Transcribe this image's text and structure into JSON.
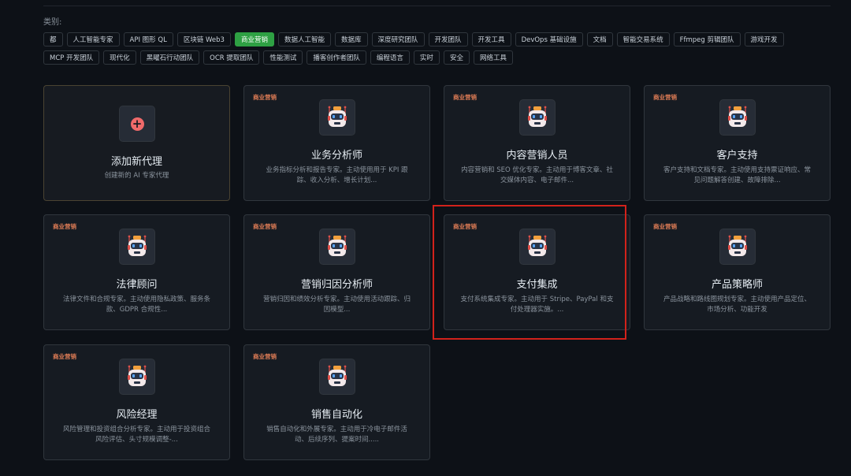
{
  "filter": {
    "label": "类别:",
    "tags": [
      "都",
      "人工智能专家",
      "API 图形 QL",
      "区块链 Web3",
      "商业营销",
      "数据人工智能",
      "数据库",
      "深度研究团队",
      "开发团队",
      "开发工具",
      "DevOps 基础设施",
      "文档",
      "智能交易系统",
      "Ffmpeg 剪辑团队",
      "游戏开发",
      "MCP 开发团队",
      "现代化",
      "黑曜石行动团队",
      "OCR 提取团队",
      "性能测试",
      "播客创作者团队",
      "编程语言",
      "实时",
      "安全",
      "网络工具"
    ],
    "active": "商业营销"
  },
  "add_card": {
    "title": "添加新代理",
    "subtitle": "创建新的 AI 专家代理",
    "icon": "plus-icon"
  },
  "agents": [
    {
      "badge": "商业营销",
      "name": "业务分析师",
      "desc": "业务指标分析和报告专家。主动使用用于 KPI 跟踪、收入分析、增长计划..."
    },
    {
      "badge": "商业营销",
      "name": "内容营销人员",
      "desc": "内容营销和 SEO 优化专家。主动用于博客文章、社交媒体内容、电子邮件..."
    },
    {
      "badge": "商业营销",
      "name": "客户支持",
      "desc": "客户支持和文档专家。主动使用支持票证响应、常见问题解答创建、故障排除..."
    },
    {
      "badge": "商业营销",
      "name": "法律顾问",
      "desc": "法律文件和合规专家。主动使用隐私政策、服务条款、GDPR 合规性..."
    },
    {
      "badge": "商业营销",
      "name": "营销归因分析师",
      "desc": "营销归因和绩效分析专家。主动使用活动跟踪、归因模型..."
    },
    {
      "badge": "商业营销",
      "name": "支付集成",
      "desc": "支付系统集成专家。主动用于 Stripe、PayPal 和支付处理器实施。..."
    },
    {
      "badge": "商业营销",
      "name": "产品策略师",
      "desc": "产品战略和路线图规划专家。主动使用产品定位、市场分析、功能开发"
    },
    {
      "badge": "商业营销",
      "name": "风险经理",
      "desc": "风险管理和投资组合分析专家。主动用于投资组合风险评估、头寸规模调整-..."
    },
    {
      "badge": "商业营销",
      "name": "销售自动化",
      "desc": "销售自动化和外展专家。主动用于冷电子邮件活动、后续序列、提案时间....."
    }
  ],
  "colors": {
    "accent": "#2ea043",
    "badge": "#e07d56",
    "highlight": "#d2221b",
    "add_icon": "#f06a6a"
  },
  "avatar_icon": "robot-icon"
}
